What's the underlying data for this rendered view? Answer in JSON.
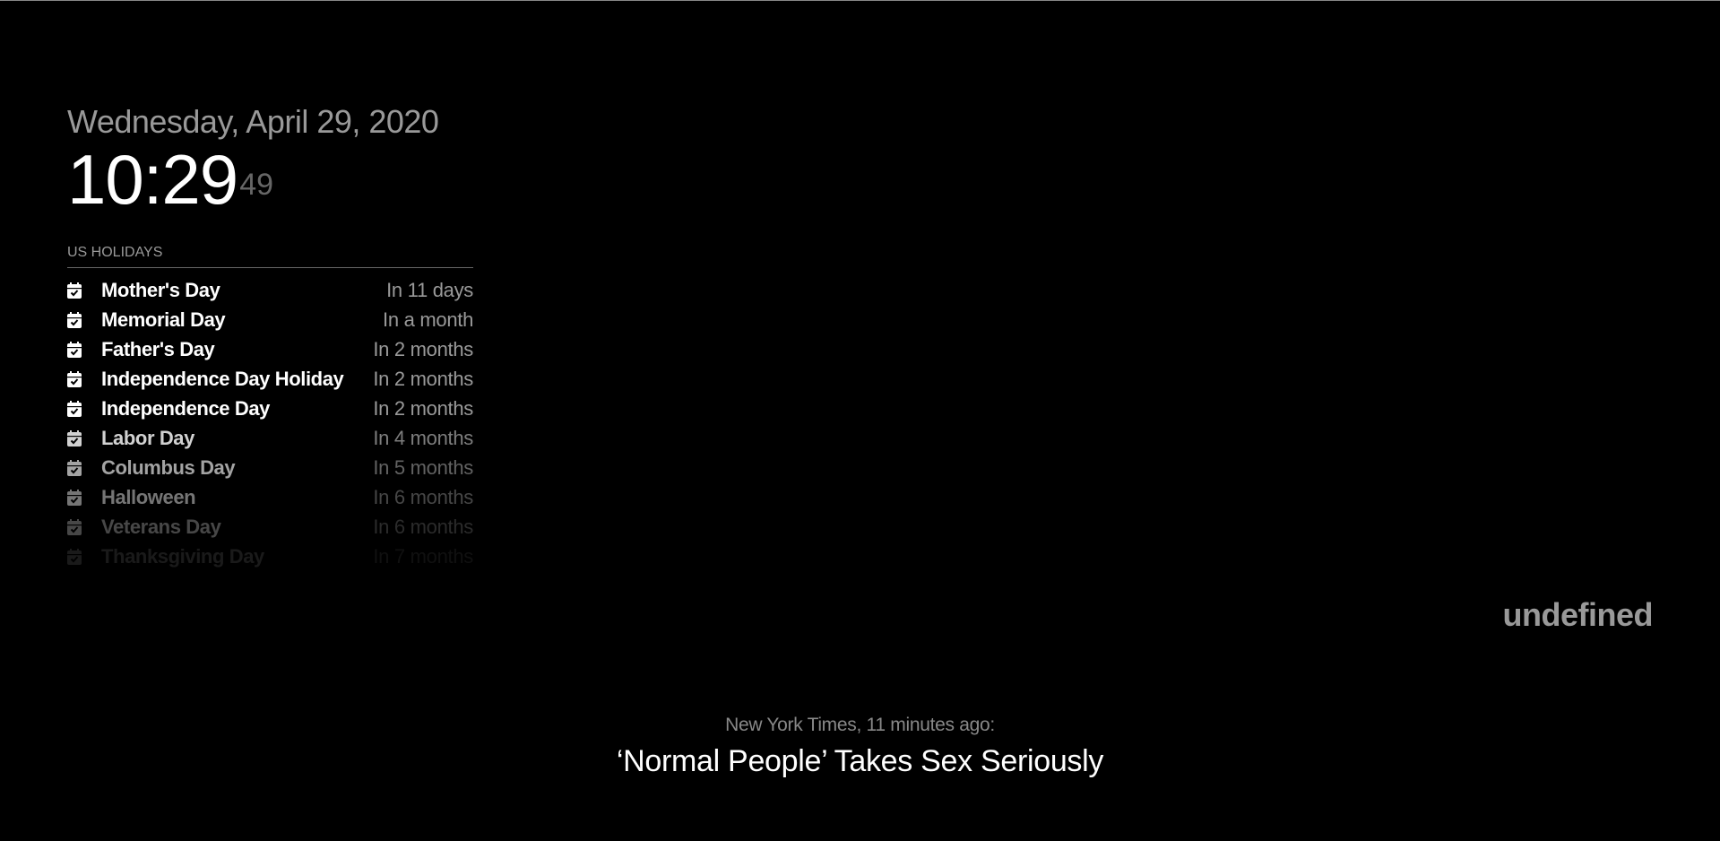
{
  "clock": {
    "date": "Wednesday, April 29, 2020",
    "time": "10:29",
    "seconds": "49"
  },
  "calendar": {
    "header": "US HOLIDAYS",
    "icon": "calendar-check-icon",
    "events": [
      {
        "title": "Mother's Day",
        "time": "In 11 days"
      },
      {
        "title": "Memorial Day",
        "time": "In a month"
      },
      {
        "title": "Father's Day",
        "time": "In 2 months"
      },
      {
        "title": "Independence Day Holiday",
        "time": "In 2 months"
      },
      {
        "title": "Independence Day",
        "time": "In 2 months"
      },
      {
        "title": "Labor Day",
        "time": "In 4 months"
      },
      {
        "title": "Columbus Day",
        "time": "In 5 months"
      },
      {
        "title": "Halloween",
        "time": "In 6 months"
      },
      {
        "title": "Veterans Day",
        "time": "In 6 months"
      },
      {
        "title": "Thanksgiving Day",
        "time": "In 7 months"
      }
    ]
  },
  "compliment": {
    "text": "undefined"
  },
  "news": {
    "source": "New York Times, 11 minutes ago:",
    "title": "‘Normal People’ Takes Sex Seriously"
  },
  "colors": {
    "background": "#000000",
    "bright": "#ffffff",
    "dimmed": "#999999"
  }
}
